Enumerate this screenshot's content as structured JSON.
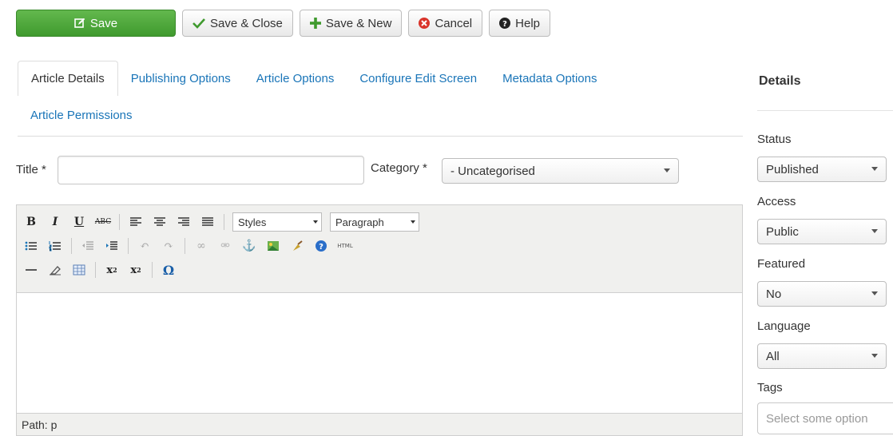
{
  "toolbar": {
    "save": "Save",
    "save_close": "Save & Close",
    "save_new": "Save & New",
    "cancel": "Cancel",
    "help": "Help"
  },
  "tabs": [
    {
      "label": "Article Details",
      "active": true
    },
    {
      "label": "Publishing Options",
      "active": false
    },
    {
      "label": "Article Options",
      "active": false
    },
    {
      "label": "Configure Edit Screen",
      "active": false
    },
    {
      "label": "Metadata Options",
      "active": false
    },
    {
      "label": "Article Permissions",
      "active": false
    }
  ],
  "form": {
    "title_label": "Title *",
    "title_value": "",
    "category_label": "Category *",
    "category_value": "- Uncategorised"
  },
  "editor": {
    "styles": "Styles",
    "format": "Paragraph",
    "path": "Path: p"
  },
  "sidebar": {
    "title": "Details",
    "status_label": "Status",
    "status_value": "Published",
    "access_label": "Access",
    "access_value": "Public",
    "featured_label": "Featured",
    "featured_value": "No",
    "language_label": "Language",
    "language_value": "All",
    "tags_label": "Tags",
    "tags_placeholder": "Select some option"
  },
  "colors": {
    "save_green": "#4aa63a",
    "link_blue": "#1a75b8",
    "cancel_red": "#d9342b"
  }
}
